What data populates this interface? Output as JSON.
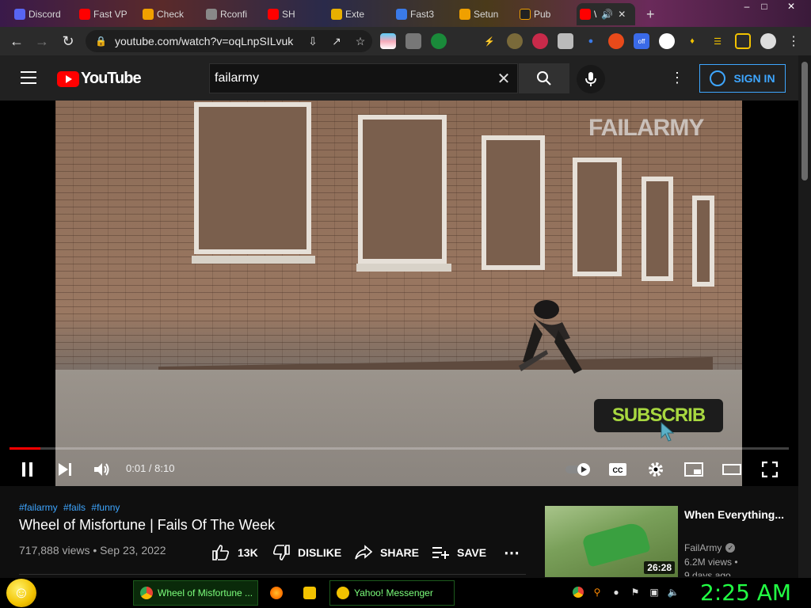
{
  "browser": {
    "tabs": [
      {
        "label": "Discord",
        "color": "#5865f2"
      },
      {
        "label": "Fast VP",
        "color": "#ff0000"
      },
      {
        "label": "Check",
        "color": "#f0a000"
      },
      {
        "label": "Rconfi",
        "color": "#888888"
      },
      {
        "label": "SH",
        "color": "#ff0000"
      },
      {
        "label": "Exte",
        "color": "#e8b000"
      },
      {
        "label": "Fast3",
        "color": "#3a7ae8"
      },
      {
        "label": "Setun",
        "color": "#f0a000"
      },
      {
        "label": "Pub",
        "color": "#222222"
      },
      {
        "label": "\\",
        "color": "#ff0000",
        "active": true
      }
    ],
    "url": "youtube.com/watch?v=oqLnpSILvuk",
    "win_controls": [
      "–",
      "□",
      "✕"
    ]
  },
  "yt": {
    "logo_text": "YouTube",
    "search_query": "failarmy",
    "signin_label": "SIGN IN"
  },
  "player": {
    "watermark": "FAILARMY",
    "subscribe_overlay": "SUBSCRIB",
    "time_display": "0:01 / 8:10",
    "progress_fraction": 0.003
  },
  "video": {
    "tags": [
      "#failarmy",
      "#fails",
      "#funny"
    ],
    "title": "Wheel of Misfortune | Fails Of The Week",
    "views_date": "717,888 views • Sep 23, 2022",
    "like_count": "13K",
    "dislike_label": "DISLIKE",
    "share_label": "SHARE",
    "save_label": "SAVE"
  },
  "sidebar": {
    "title": "When Everything...",
    "channel": "FailArmy",
    "views": "6.2M views •",
    "ago": "9 days ago",
    "duration": "26:28"
  },
  "taskbar": {
    "tasks": [
      {
        "label": "Wheel of Misfortune ...",
        "color": "#4285f4",
        "active": true
      },
      {
        "label": "",
        "color": "#ff7a00"
      },
      {
        "label": "",
        "color": "#f2c200"
      },
      {
        "label": "Yahoo! Messenger",
        "color": "#f2c200"
      }
    ],
    "clock": "2:25 AM"
  }
}
